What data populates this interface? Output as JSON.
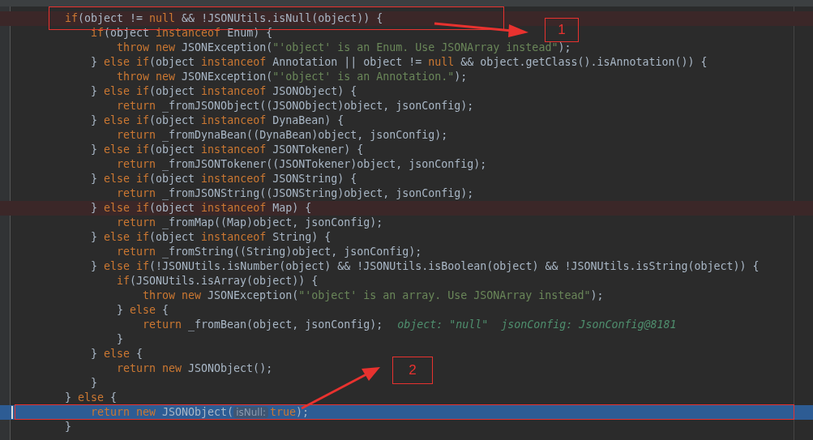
{
  "lines": [
    {
      "kind": "breakpoint",
      "outlined": true,
      "tokens": [
        {
          "kind": "kw",
          "text": "if"
        },
        {
          "kind": "plain",
          "text": "(object != "
        },
        {
          "kind": "kw",
          "text": "null"
        },
        {
          "kind": "plain",
          "text": " && !JSONUtils.isNull(object)) {"
        }
      ],
      "children": [
        {
          "kind": "plain",
          "outlined": false,
          "tokens": [
            {
              "kind": "kw",
              "text": "if"
            },
            {
              "kind": "plain",
              "text": "(object "
            },
            {
              "kind": "kw",
              "text": "instanceof"
            },
            {
              "kind": "plain",
              "text": " Enum) {"
            }
          ],
          "children": [
            {
              "kind": "plain",
              "outlined": false,
              "tokens": [
                {
                  "kind": "kw",
                  "text": "throw new"
                },
                {
                  "kind": "plain",
                  "text": " JSONException("
                },
                {
                  "kind": "str",
                  "text": "\"'object' is an Enum. Use JSONArray instead\""
                },
                {
                  "kind": "plain",
                  "text": ");"
                }
              ]
            }
          ]
        },
        {
          "kind": "plain",
          "outlined": false,
          "tokens": [
            {
              "kind": "plain",
              "text": "} "
            },
            {
              "kind": "kw",
              "text": "else if"
            },
            {
              "kind": "plain",
              "text": "(object "
            },
            {
              "kind": "kw",
              "text": "instanceof"
            },
            {
              "kind": "plain",
              "text": " Annotation || object != "
            },
            {
              "kind": "kw",
              "text": "null"
            },
            {
              "kind": "plain",
              "text": " && object.getClass().isAnnotation()) {"
            }
          ],
          "children": [
            {
              "kind": "plain",
              "outlined": false,
              "tokens": [
                {
                  "kind": "kw",
                  "text": "throw new"
                },
                {
                  "kind": "plain",
                  "text": " JSONException("
                },
                {
                  "kind": "str",
                  "text": "\"'object' is an Annotation.\""
                },
                {
                  "kind": "plain",
                  "text": ");"
                }
              ]
            }
          ]
        },
        {
          "kind": "plain",
          "outlined": false,
          "tokens": [
            {
              "kind": "plain",
              "text": "} "
            },
            {
              "kind": "kw",
              "text": "else if"
            },
            {
              "kind": "plain",
              "text": "(object "
            },
            {
              "kind": "kw",
              "text": "instanceof"
            },
            {
              "kind": "plain",
              "text": " JSONObject) {"
            }
          ],
          "children": [
            {
              "kind": "plain",
              "outlined": false,
              "tokens": [
                {
                  "kind": "kw",
                  "text": "return"
                },
                {
                  "kind": "plain",
                  "text": " _fromJSONObject((JSONObject)object, jsonConfig);"
                }
              ]
            }
          ]
        },
        {
          "kind": "plain",
          "outlined": false,
          "tokens": [
            {
              "kind": "plain",
              "text": "} "
            },
            {
              "kind": "kw",
              "text": "else if"
            },
            {
              "kind": "plain",
              "text": "(object "
            },
            {
              "kind": "kw",
              "text": "instanceof"
            },
            {
              "kind": "plain",
              "text": " DynaBean) {"
            }
          ],
          "children": [
            {
              "kind": "plain",
              "outlined": false,
              "tokens": [
                {
                  "kind": "kw",
                  "text": "return"
                },
                {
                  "kind": "plain",
                  "text": " _fromDynaBean((DynaBean)object, jsonConfig);"
                }
              ]
            }
          ]
        },
        {
          "kind": "plain",
          "outlined": false,
          "tokens": [
            {
              "kind": "plain",
              "text": "} "
            },
            {
              "kind": "kw",
              "text": "else if"
            },
            {
              "kind": "plain",
              "text": "(object "
            },
            {
              "kind": "kw",
              "text": "instanceof"
            },
            {
              "kind": "plain",
              "text": " JSONTokener) {"
            }
          ],
          "children": [
            {
              "kind": "plain",
              "outlined": false,
              "tokens": [
                {
                  "kind": "kw",
                  "text": "return"
                },
                {
                  "kind": "plain",
                  "text": " _fromJSONTokener((JSONTokener)object, jsonConfig);"
                }
              ]
            }
          ]
        },
        {
          "kind": "plain",
          "outlined": false,
          "tokens": [
            {
              "kind": "plain",
              "text": "} "
            },
            {
              "kind": "kw",
              "text": "else if"
            },
            {
              "kind": "plain",
              "text": "(object "
            },
            {
              "kind": "kw",
              "text": "instanceof"
            },
            {
              "kind": "plain",
              "text": " JSONString) {"
            }
          ],
          "children": [
            {
              "kind": "plain",
              "outlined": false,
              "tokens": [
                {
                  "kind": "kw",
                  "text": "return"
                },
                {
                  "kind": "plain",
                  "text": " _fromJSONString((JSONString)object, jsonConfig);"
                }
              ]
            }
          ]
        },
        {
          "kind": "breakpoint",
          "outlined": false,
          "tokens": [
            {
              "kind": "plain",
              "text": "} "
            },
            {
              "kind": "kw",
              "text": "else if"
            },
            {
              "kind": "plain",
              "text": "(object "
            },
            {
              "kind": "kw",
              "text": "instanceof"
            },
            {
              "kind": "plain",
              "text": " Map) {"
            }
          ],
          "children": [
            {
              "kind": "plain",
              "outlined": false,
              "tokens": [
                {
                  "kind": "kw",
                  "text": "return"
                },
                {
                  "kind": "plain",
                  "text": " _fromMap((Map)object, jsonConfig);"
                }
              ]
            }
          ]
        },
        {
          "kind": "plain",
          "outlined": false,
          "tokens": [
            {
              "kind": "plain",
              "text": "} "
            },
            {
              "kind": "kw",
              "text": "else if"
            },
            {
              "kind": "plain",
              "text": "(object "
            },
            {
              "kind": "kw",
              "text": "instanceof"
            },
            {
              "kind": "plain",
              "text": " String) {"
            }
          ],
          "children": [
            {
              "kind": "plain",
              "outlined": false,
              "tokens": [
                {
                  "kind": "kw",
                  "text": "return"
                },
                {
                  "kind": "plain",
                  "text": " _fromString((String)object, jsonConfig);"
                }
              ]
            }
          ]
        },
        {
          "kind": "plain",
          "outlined": false,
          "tokens": [
            {
              "kind": "plain",
              "text": "} "
            },
            {
              "kind": "kw",
              "text": "else if"
            },
            {
              "kind": "plain",
              "text": "(!JSONUtils.isNumber(object) && !JSONUtils.isBoolean(object) && !JSONUtils.isString(object)) {"
            }
          ],
          "children": [
            {
              "kind": "plain",
              "outlined": false,
              "tokens": [
                {
                  "kind": "kw",
                  "text": "if"
                },
                {
                  "kind": "plain",
                  "text": "(JSONUtils.isArray(object)) {"
                }
              ],
              "children": [
                {
                  "kind": "plain",
                  "outlined": false,
                  "tokens": [
                    {
                      "kind": "kw",
                      "text": "throw new"
                    },
                    {
                      "kind": "plain",
                      "text": " JSONException("
                    },
                    {
                      "kind": "str",
                      "text": "\"'object' is an array. Use JSONArray instead\""
                    },
                    {
                      "kind": "plain",
                      "text": ");"
                    }
                  ]
                }
              ]
            },
            {
              "kind": "plain",
              "outlined": false,
              "tokens": [
                {
                  "kind": "plain",
                  "text": "} "
                },
                {
                  "kind": "kw",
                  "text": "else"
                },
                {
                  "kind": "plain",
                  "text": " {"
                }
              ],
              "children": [
                {
                  "kind": "plain",
                  "outlined": false,
                  "tokens": [
                    {
                      "kind": "kw",
                      "text": "return"
                    },
                    {
                      "kind": "plain",
                      "text": " _fromBean(object, jsonConfig);"
                    },
                    {
                      "kind": "hint",
                      "text": "object: \"null\"  jsonConfig: JsonConfig@8181"
                    }
                  ]
                }
              ]
            },
            {
              "kind": "plain",
              "outlined": false,
              "tokens": [
                {
                  "kind": "plain",
                  "text": "}"
                }
              ]
            }
          ]
        },
        {
          "kind": "plain",
          "outlined": false,
          "tokens": [
            {
              "kind": "plain",
              "text": "} "
            },
            {
              "kind": "kw",
              "text": "else"
            },
            {
              "kind": "plain",
              "text": " {"
            }
          ],
          "children": [
            {
              "kind": "plain",
              "outlined": false,
              "tokens": [
                {
                  "kind": "kw",
                  "text": "return new"
                },
                {
                  "kind": "plain",
                  "text": " JSONObject();"
                }
              ]
            }
          ]
        },
        {
          "kind": "plain",
          "outlined": false,
          "tokens": [
            {
              "kind": "plain",
              "text": "}"
            }
          ]
        }
      ]
    },
    {
      "kind": "plain",
      "outlined": false,
      "tokens": [
        {
          "kind": "plain",
          "text": "} "
        },
        {
          "kind": "kw",
          "text": "else"
        },
        {
          "kind": "plain",
          "text": " {"
        }
      ],
      "children": [
        {
          "kind": "current",
          "outlined": true,
          "tokens": [
            {
              "kind": "kw",
              "text": "return new"
            },
            {
              "kind": "plain",
              "text": " JSONObject("
            },
            {
              "kind": "inlay",
              "text": "isNull:"
            },
            {
              "kind": "kw",
              "text": "true"
            },
            {
              "kind": "plain",
              "text": ");"
            }
          ]
        }
      ]
    },
    {
      "kind": "plain",
      "outlined": false,
      "tokens": [
        {
          "kind": "plain",
          "text": "}"
        }
      ]
    }
  ],
  "annotations": [
    {
      "label": "1"
    },
    {
      "label": "2"
    }
  ]
}
